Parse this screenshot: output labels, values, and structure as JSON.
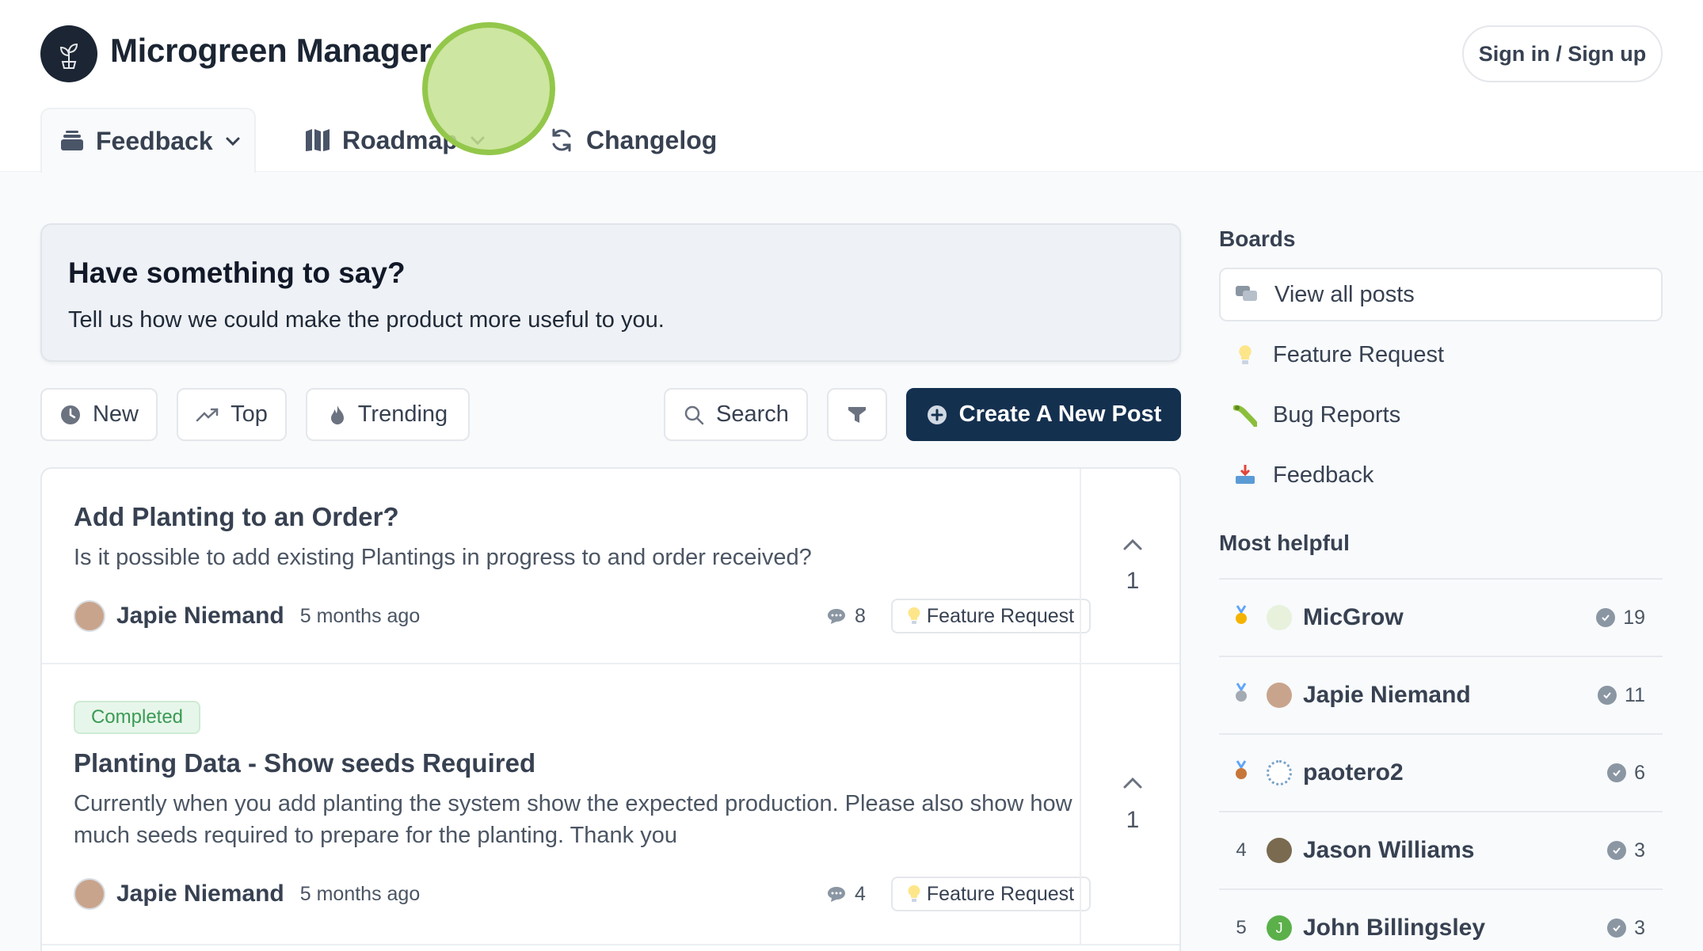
{
  "app": {
    "title": "Microgreen Manager",
    "signin_label": "Sign in / Sign up"
  },
  "nav": {
    "tabs": [
      {
        "label": "Feedback",
        "icon": "inbox-stack-icon"
      },
      {
        "label": "Roadmap",
        "icon": "roadmap-icon"
      },
      {
        "label": "Changelog",
        "icon": "refresh-icon"
      }
    ]
  },
  "banner": {
    "title": "Have something to say?",
    "subtitle": "Tell us how we could make the product more useful to you."
  },
  "toolbar": {
    "new_label": "New",
    "top_label": "Top",
    "trending_label": "Trending",
    "search_label": "Search",
    "create_label": "Create A New Post"
  },
  "posts": [
    {
      "title": "Add Planting to an Order?",
      "description": "Is it possible to add existing Plantings in progress to and order received?",
      "author": "Japie Niemand",
      "time": "5 months ago",
      "comments": "8",
      "tag": "Feature Request",
      "votes": "1"
    },
    {
      "status": "Completed",
      "title": "Planting Data - Show seeds Required",
      "description": "Currently when you add planting the system show the expected production. Please also show how much seeds required to prepare for the planting. Thank you",
      "author": "Japie Niemand",
      "time": "5 months ago",
      "comments": "4",
      "tag": "Feature Request",
      "votes": "1"
    }
  ],
  "sidebar": {
    "boards_heading": "Boards",
    "boards": [
      {
        "label": "View all posts",
        "icon": "chat-bubbles-icon"
      },
      {
        "label": "Feature Request",
        "icon": "lightbulb-icon"
      },
      {
        "label": "Bug Reports",
        "icon": "bug-icon"
      },
      {
        "label": "Feedback",
        "icon": "inbox-tray-icon"
      }
    ],
    "helpful_heading": "Most helpful",
    "helpers": [
      {
        "rank": "1",
        "medal": "gold-medal-icon",
        "name": "MicGrow",
        "score": "19"
      },
      {
        "rank": "2",
        "medal": "silver-medal-icon",
        "name": "Japie Niemand",
        "score": "11"
      },
      {
        "rank": "3",
        "medal": "bronze-medal-icon",
        "name": "paotero2",
        "score": "6"
      },
      {
        "rank": "4",
        "name": "Jason Williams",
        "score": "3"
      },
      {
        "rank": "5",
        "name": "John Billingsley",
        "score": "3",
        "initial": "J"
      }
    ]
  },
  "colors": {
    "brand_dark": "#1b2533",
    "primary_button": "#14304f",
    "completed_green": "#3a9a55",
    "page_bg": "#f8fafc"
  }
}
